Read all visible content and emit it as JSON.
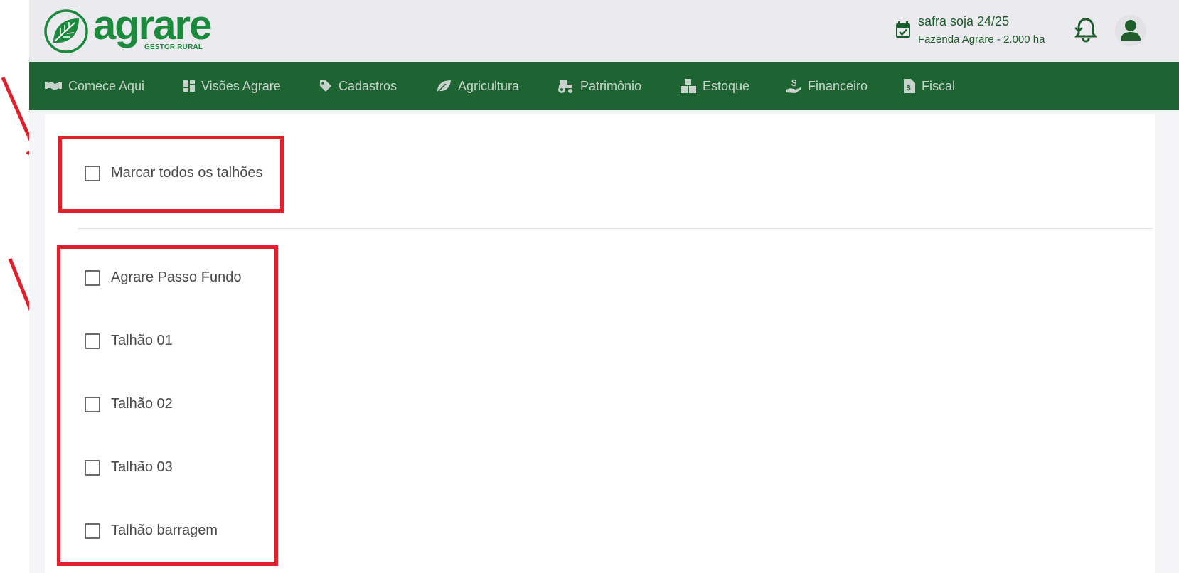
{
  "brand": {
    "name": "agrare",
    "tagline": "GESTOR RURAL",
    "color": "#1c8a3c"
  },
  "season_selector": {
    "title": "safra soja 24/25",
    "farm": "Fazenda Agrare - 2.000 ha",
    "icon": "calendar-check-icon"
  },
  "header_actions": {
    "notifications_icon": "bell-icon",
    "user_icon": "user-icon"
  },
  "nav": {
    "items": [
      {
        "label": "Comece Aqui",
        "icon": "handshake-icon"
      },
      {
        "label": "Visões Agrare",
        "icon": "dashboard-icon"
      },
      {
        "label": "Cadastros",
        "icon": "tag-icon"
      },
      {
        "label": "Agricultura",
        "icon": "leaf-icon"
      },
      {
        "label": "Patrimônio",
        "icon": "tractor-icon"
      },
      {
        "label": "Estoque",
        "icon": "boxes-icon"
      },
      {
        "label": "Financeiro",
        "icon": "hand-dollar-icon"
      },
      {
        "label": "Fiscal",
        "icon": "invoice-icon"
      }
    ]
  },
  "fields": {
    "select_all": {
      "label": "Marcar todos os talhões",
      "checked": false
    },
    "items": [
      {
        "label": "Agrare Passo Fundo",
        "checked": false
      },
      {
        "label": "Talhão 01",
        "checked": false
      },
      {
        "label": "Talhão 02",
        "checked": false
      },
      {
        "label": "Talhão 03",
        "checked": false
      },
      {
        "label": "Talhão barragem",
        "checked": false
      }
    ]
  },
  "colors": {
    "nav_bg": "#1d6432",
    "annotation": "#e0202a",
    "topbar_bg": "#ebebef"
  }
}
